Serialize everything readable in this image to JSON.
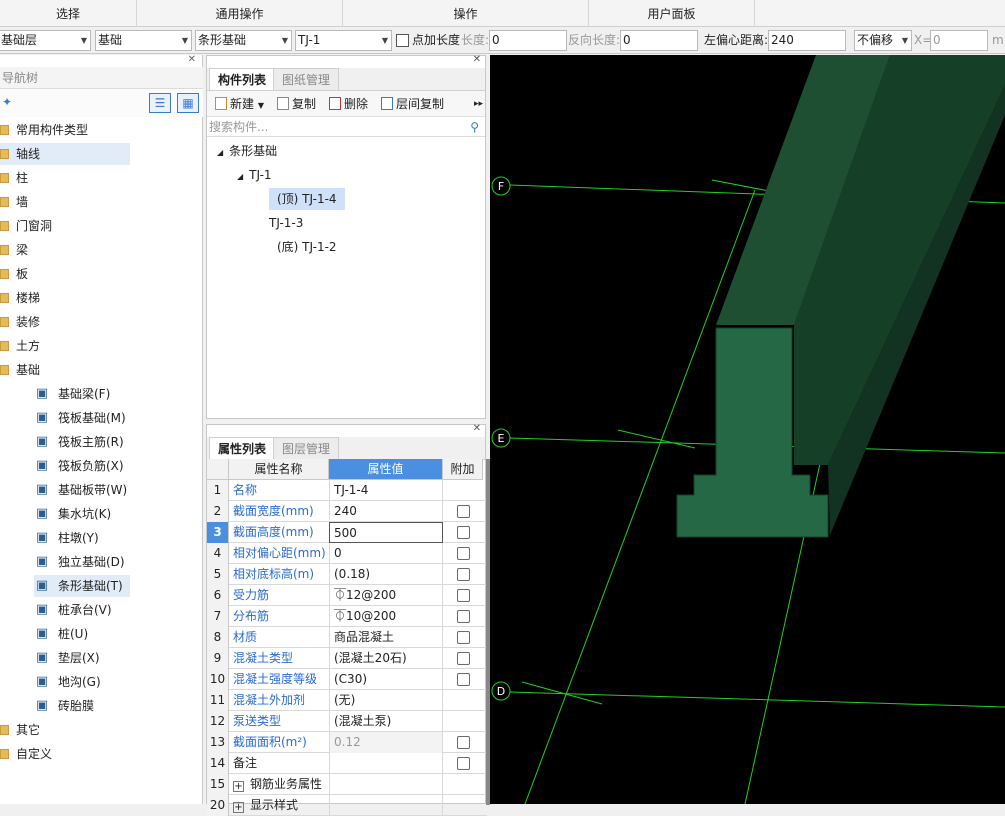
{
  "menubar": {
    "groups": [
      "选择",
      "通用操作",
      "操作",
      "用户面板"
    ]
  },
  "toolbar": {
    "floor": "基础层",
    "category": "基础",
    "component_type": "条形基础",
    "component": "TJ-1",
    "point_length_label": "点加长度",
    "length_label": "长度:",
    "length_value": "0",
    "reverse_length_label": "反向长度:",
    "reverse_length_value": "0",
    "left_offset_label": "左偏心距离:",
    "left_offset_value": "240",
    "offset_mode": "不偏移",
    "x_label": "X=",
    "x_value": "0",
    "unit": "m"
  },
  "nav": {
    "title": "导航树",
    "items": [
      {
        "label": "常用构件类型"
      },
      {
        "label": "轴线"
      },
      {
        "label": "柱"
      },
      {
        "label": "墙"
      },
      {
        "label": "门窗洞"
      },
      {
        "label": "梁"
      },
      {
        "label": "板"
      },
      {
        "label": "楼梯"
      },
      {
        "label": "装修"
      },
      {
        "label": "土方"
      },
      {
        "label": "基础"
      }
    ],
    "sub_items": [
      {
        "label": "基础梁(F)",
        "icon": "beam-icon"
      },
      {
        "label": "筏板基础(M)",
        "icon": "raft-icon"
      },
      {
        "label": "筏板主筋(R)",
        "icon": "raft-main-rebar-icon"
      },
      {
        "label": "筏板负筋(X)",
        "icon": "raft-neg-rebar-icon"
      },
      {
        "label": "基础板带(W)",
        "icon": "slab-strip-icon"
      },
      {
        "label": "集水坑(K)",
        "icon": "sump-icon"
      },
      {
        "label": "柱墩(Y)",
        "icon": "pier-icon"
      },
      {
        "label": "独立基础(D)",
        "icon": "isolated-footing-icon"
      },
      {
        "label": "条形基础(T)",
        "icon": "strip-footing-icon"
      },
      {
        "label": "桩承台(V)",
        "icon": "pile-cap-icon"
      },
      {
        "label": "桩(U)",
        "icon": "pile-icon"
      },
      {
        "label": "垫层(X)",
        "icon": "cushion-icon"
      },
      {
        "label": "地沟(G)",
        "icon": "trench-icon"
      },
      {
        "label": "砖胎膜",
        "icon": "brick-mold-icon"
      }
    ],
    "tail_items": [
      {
        "label": "其它"
      },
      {
        "label": "自定义"
      }
    ]
  },
  "component_panel": {
    "tab_active": "构件列表",
    "tab_inactive": "图纸管理",
    "tool_new": "新建",
    "tool_copy": "复制",
    "tool_delete": "删除",
    "tool_floor_copy": "层间复制",
    "search_placeholder": "搜索构件...",
    "tree": {
      "root": "条形基础",
      "child": "TJ-1",
      "leaves": [
        "(顶) TJ-1-4",
        "TJ-1-3",
        "(底) TJ-1-2"
      ]
    }
  },
  "property_panel": {
    "tab_active": "属性列表",
    "tab_inactive": "图层管理",
    "headers": [
      "属性名称",
      "属性值",
      "附加"
    ],
    "rows": [
      {
        "n": "1",
        "name": "名称",
        "value": "TJ-1-4",
        "check": false
      },
      {
        "n": "2",
        "name": "截面宽度(mm)",
        "value": "240",
        "check": true
      },
      {
        "n": "3",
        "name": "截面高度(mm)",
        "value": "500",
        "check": true
      },
      {
        "n": "4",
        "name": "相对偏心距(mm)",
        "value": "0",
        "check": true
      },
      {
        "n": "5",
        "name": "相对底标高(m)",
        "value": "(0.18)",
        "check": true
      },
      {
        "n": "6",
        "name": "受力筋",
        "value": "⏁12@200",
        "check": true
      },
      {
        "n": "7",
        "name": "分布筋",
        "value": "⏁10@200",
        "check": true
      },
      {
        "n": "8",
        "name": "材质",
        "value": "商品混凝土",
        "check": true
      },
      {
        "n": "9",
        "name": "混凝土类型",
        "value": "(混凝土20石)",
        "check": true
      },
      {
        "n": "10",
        "name": "混凝土强度等级",
        "value": "(C30)",
        "check": true
      },
      {
        "n": "11",
        "name": "混凝土外加剂",
        "value": "(无)",
        "check": false
      },
      {
        "n": "12",
        "name": "泵送类型",
        "value": "(混凝土泵)",
        "check": false
      },
      {
        "n": "13",
        "name": "截面面积(m²)",
        "value": "0.12",
        "check": true
      },
      {
        "n": "14",
        "name": "备注",
        "value": "",
        "check": true
      },
      {
        "n": "15",
        "name": "钢筋业务属性",
        "value": "",
        "check": false
      },
      {
        "n": "20",
        "name": "显示样式",
        "value": "",
        "check": false
      }
    ]
  },
  "viewport": {
    "axes": [
      "F",
      "E",
      "D"
    ],
    "grid_color": "#1fd11f",
    "body_color": "#1f5a3a"
  }
}
